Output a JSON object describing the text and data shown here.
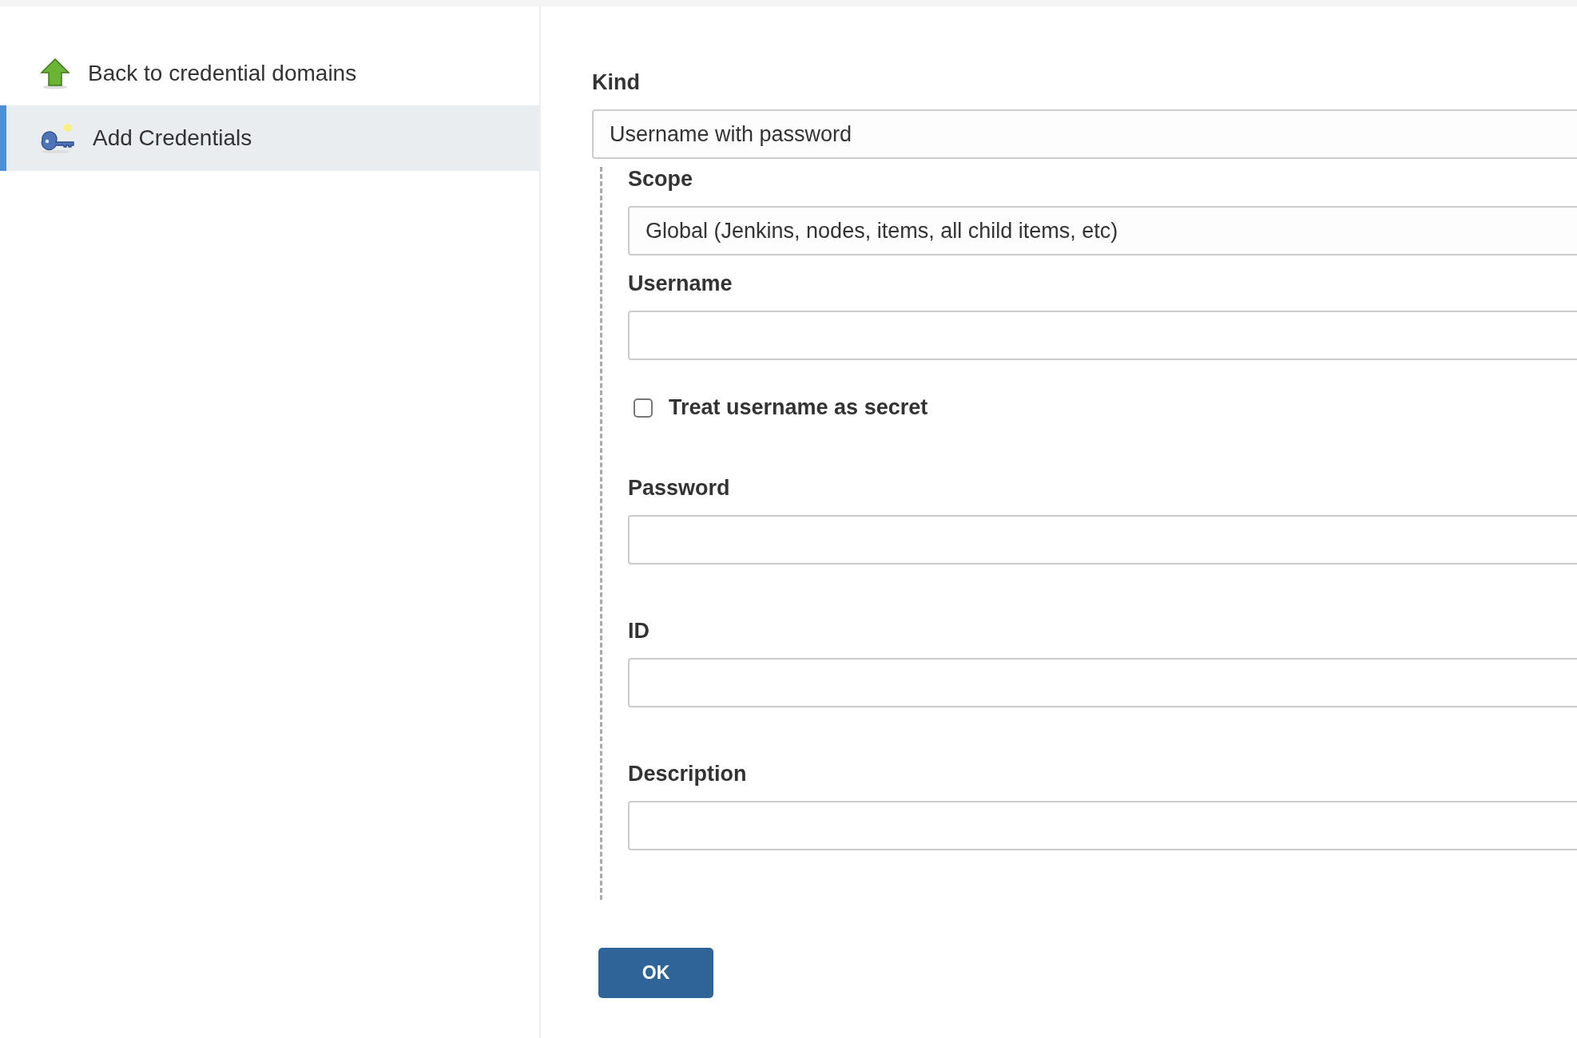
{
  "sidebar": {
    "items": [
      {
        "label": "Back to credential domains",
        "kind": "up",
        "selected": false
      },
      {
        "label": "Add Credentials",
        "kind": "key",
        "selected": true
      }
    ]
  },
  "form": {
    "kind": {
      "label": "Kind",
      "value": "Username with password"
    },
    "fields": [
      {
        "kind": "select",
        "label": "Scope",
        "value": "Global (Jenkins, nodes, items, all child items, etc)"
      },
      {
        "kind": "text",
        "label": "Username"
      },
      {
        "kind": "checkbox",
        "label": "Treat username as secret",
        "checked": false
      },
      {
        "kind": "password",
        "label": "Password"
      },
      {
        "kind": "text",
        "label": "ID"
      },
      {
        "kind": "text",
        "label": "Description"
      }
    ],
    "submit": "OK"
  }
}
